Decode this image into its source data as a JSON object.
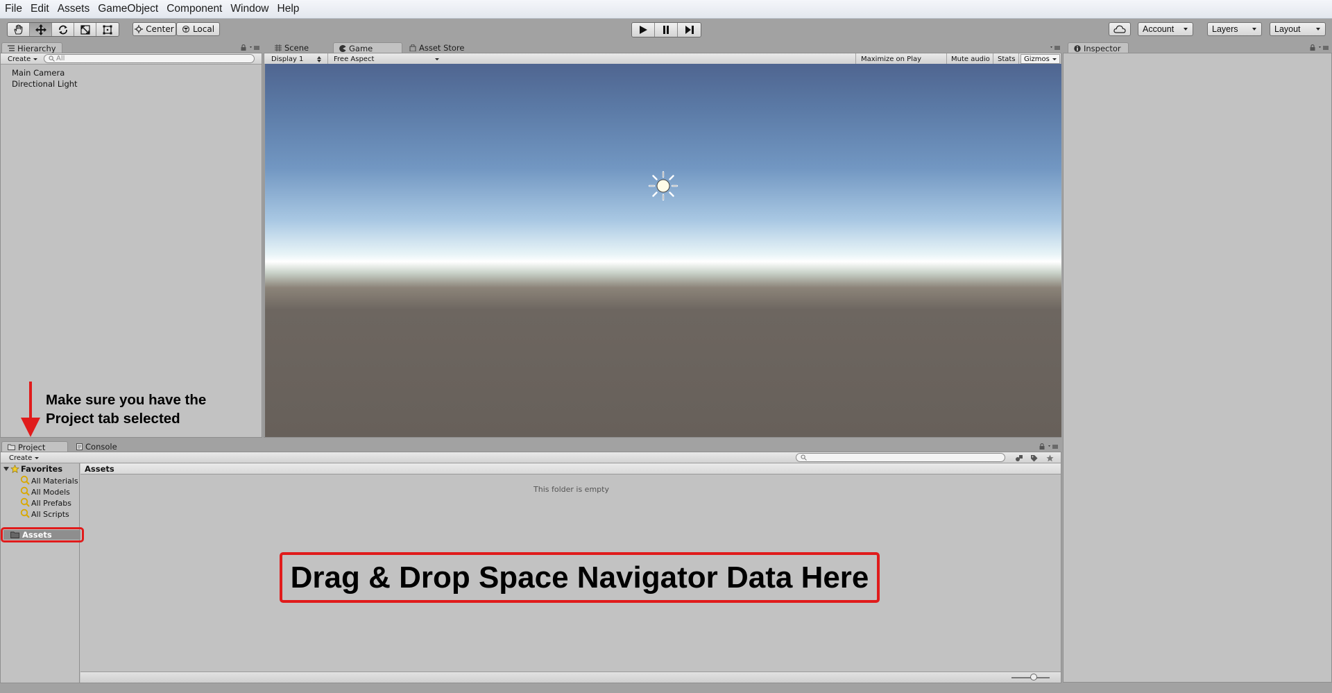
{
  "menu": [
    "File",
    "Edit",
    "Assets",
    "GameObject",
    "Component",
    "Window",
    "Help"
  ],
  "toolbar": {
    "pivot_label": "Center",
    "space_label": "Local",
    "account_label": "Account",
    "layers_label": "Layers",
    "layout_label": "Layout"
  },
  "hierarchy": {
    "tab_label": "Hierarchy",
    "create_label": "Create",
    "search_placeholder": "All",
    "items": [
      "Main Camera",
      "Directional Light"
    ]
  },
  "center_tabs": {
    "scene_label": "Scene",
    "game_label": "Game",
    "asset_store_label": "Asset Store"
  },
  "game_bar": {
    "display_label": "Display 1",
    "aspect_label": "Free Aspect",
    "maximize_label": "Maximize on Play",
    "mute_label": "Mute audio",
    "stats_label": "Stats",
    "gizmos_label": "Gizmos"
  },
  "inspector": {
    "tab_label": "Inspector"
  },
  "project": {
    "tab_label": "Project",
    "console_label": "Console",
    "create_label": "Create",
    "favorites_label": "Favorites",
    "favorites": [
      "All Materials",
      "All Models",
      "All Prefabs",
      "All Scripts"
    ],
    "assets_folder_label": "Assets",
    "breadcrumb": "Assets",
    "empty_message": "This folder is empty"
  },
  "annotations": {
    "project_tab_note_line1": "Make sure you have the",
    "project_tab_note_line2": "Project tab selected",
    "drop_zone_label": "Drag & Drop Space Navigator Data Here",
    "highlight_color": "#e01b1b"
  }
}
